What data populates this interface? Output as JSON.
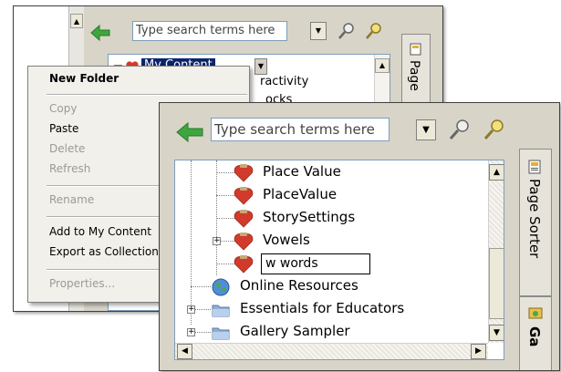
{
  "back_window": {
    "search_placeholder": "Type search terms here",
    "tree": {
      "root_label": "My Content",
      "partial_1": "ractivity",
      "partial_2": "ocks"
    },
    "tab_label": "Page"
  },
  "context_menu": {
    "items": [
      {
        "label": "New Folder",
        "state": "bold"
      },
      {
        "label": "Copy",
        "state": "disabled"
      },
      {
        "label": "Paste",
        "state": "enabled"
      },
      {
        "label": "Delete",
        "state": "disabled"
      },
      {
        "label": "Refresh",
        "state": "disabled"
      },
      {
        "label": "Rename",
        "state": "disabled"
      },
      {
        "label": "Add to My Content",
        "state": "enabled"
      },
      {
        "label": "Export as Collection",
        "state": "enabled"
      },
      {
        "label": "Properties...",
        "state": "disabled"
      }
    ]
  },
  "front_window": {
    "search_placeholder": "Type search terms here",
    "tree": {
      "items": [
        {
          "label": "Place Value",
          "icon": "heart-gift-icon"
        },
        {
          "label": "PlaceValue",
          "icon": "heart-gift-icon"
        },
        {
          "label": "StorySettings",
          "icon": "heart-gift-icon"
        },
        {
          "label": "Vowels",
          "icon": "heart-gift-icon"
        },
        {
          "label": "w words",
          "icon": "heart-gift-icon"
        },
        {
          "label": "Online Resources",
          "icon": "globe-icon"
        },
        {
          "label": "Essentials for Educators",
          "icon": "folder-icon"
        },
        {
          "label": "Gallery Sampler",
          "icon": "folder-icon"
        }
      ]
    },
    "tabs": {
      "page_sorter": "Page Sorter",
      "gallery_partial": "Ga"
    }
  },
  "colors": {
    "window_bg": "#d8d4c8",
    "selection": "#0a246a",
    "arrow_green": "#2f9a2f",
    "heart_red": "#d23b2b"
  }
}
